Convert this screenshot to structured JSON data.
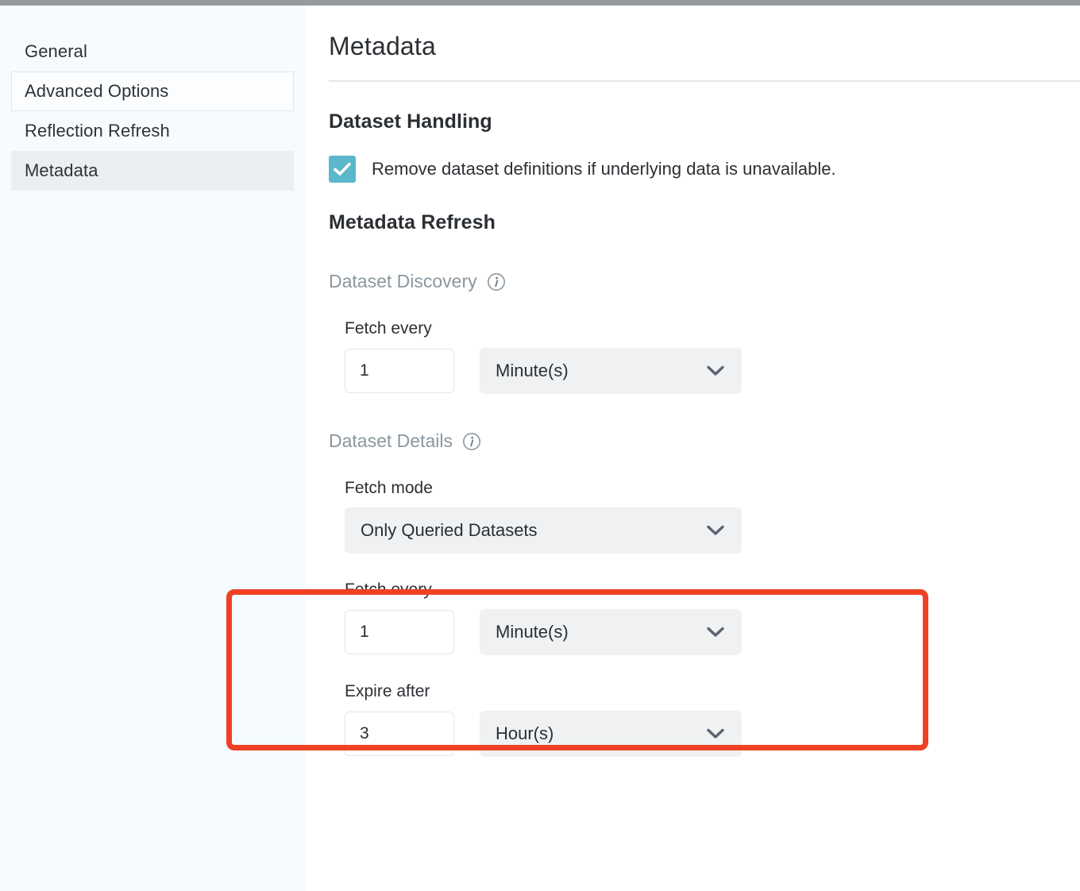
{
  "window": {
    "chrome_bar_color": "#979a9d"
  },
  "sidebar": {
    "items": [
      {
        "label": "General",
        "state": "default"
      },
      {
        "label": "Advanced Options",
        "state": "hover"
      },
      {
        "label": "Reflection Refresh",
        "state": "default"
      },
      {
        "label": "Metadata",
        "state": "active"
      }
    ]
  },
  "main": {
    "page_title": "Metadata",
    "dataset_handling": {
      "heading": "Dataset Handling",
      "checkbox": {
        "label": "Remove dataset definitions if underlying data is unavailable.",
        "checked": true,
        "color": "#5bb7cb",
        "icon": "check-icon"
      }
    },
    "metadata_refresh": {
      "heading": "Metadata Refresh",
      "dataset_discovery": {
        "heading": "Dataset Discovery",
        "info_icon": "info-circle-icon",
        "fetch_every": {
          "label": "Fetch every",
          "value": "1",
          "unit": "Minute(s)",
          "unit_icon": "chevron-down-icon"
        }
      },
      "dataset_details": {
        "heading": "Dataset Details",
        "info_icon": "info-circle-icon",
        "fetch_mode": {
          "label": "Fetch mode",
          "value": "Only Queried Datasets",
          "icon": "chevron-down-icon"
        },
        "fetch_every": {
          "label": "Fetch every",
          "value": "1",
          "unit": "Minute(s)",
          "unit_icon": "chevron-down-icon"
        },
        "expire_after": {
          "label": "Expire after",
          "value": "3",
          "unit": "Hour(s)",
          "unit_icon": "chevron-down-icon"
        }
      }
    }
  },
  "annotation": {
    "color": "#ef4123",
    "shape": "rectangle-highlight"
  }
}
